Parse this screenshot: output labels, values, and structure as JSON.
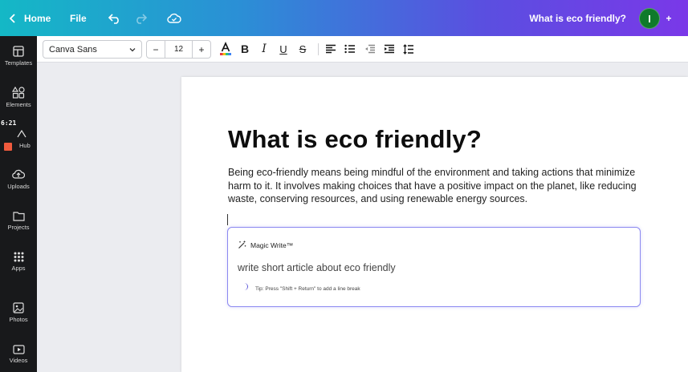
{
  "topbar": {
    "home_label": "Home",
    "file_label": "File",
    "doc_title": "What is eco friendly?",
    "avatar_initial": "I",
    "plus_label": "+"
  },
  "sidebar": {
    "items": [
      {
        "label": "Templates",
        "icon": "templates-icon"
      },
      {
        "label": "Elements",
        "icon": "elements-icon"
      },
      {
        "label": "Hub",
        "icon": "hub-icon"
      },
      {
        "label": "Uploads",
        "icon": "uploads-icon"
      },
      {
        "label": "Projects",
        "icon": "projects-icon"
      },
      {
        "label": "Apps",
        "icon": "apps-icon"
      },
      {
        "label": "Photos",
        "icon": "photos-icon"
      },
      {
        "label": "Videos",
        "icon": "videos-icon"
      }
    ],
    "recording_time": "6:21"
  },
  "format_toolbar": {
    "font_family": "Canva Sans",
    "font_size": "12",
    "minus_label": "−",
    "plus_label": "+"
  },
  "document": {
    "heading": "What is eco friendly?",
    "paragraph": "Being eco-friendly means being mindful of the environment and taking actions that minimize harm to it. It involves making choices that have a positive impact on the planet, like reducing waste, conserving resources, and using renewable energy sources."
  },
  "magic_write": {
    "title": "Magic Write™",
    "prompt": "write short article about eco friendly",
    "tip": "Tip: Press \"Shift + Return\" to add a line break"
  },
  "colors": {
    "sidebar_bg": "#18191b",
    "accent": "#8b88f0",
    "avatar_bg": "#0f7a2b"
  }
}
